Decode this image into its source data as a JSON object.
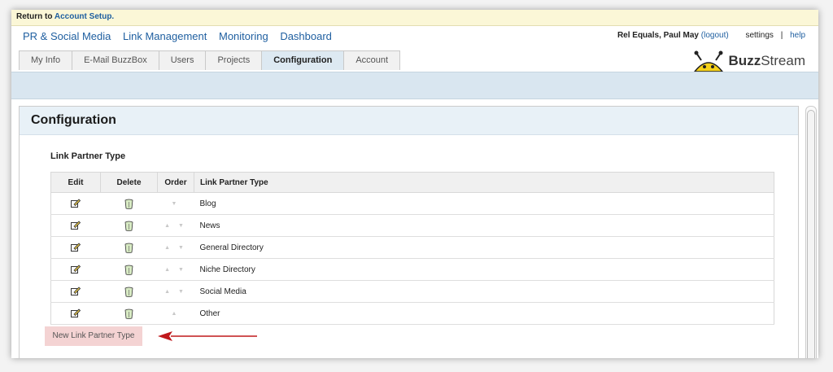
{
  "topbar": {
    "prefix": "Return to",
    "link": "Account Setup."
  },
  "mainnav": [
    "PR & Social Media",
    "Link Management",
    "Monitoring",
    "Dashboard"
  ],
  "user": {
    "name": "Rel Equals, Paul May",
    "logout": "(logout)",
    "settings": "settings",
    "separator": "|",
    "help": "help"
  },
  "brand": {
    "bold": "Buzz",
    "rest": "Stream"
  },
  "tabs": [
    "My Info",
    "E-Mail BuzzBox",
    "Users",
    "Projects",
    "Configuration",
    "Account"
  ],
  "active_tab": "Configuration",
  "page": {
    "title": "Configuration",
    "section": "Link Partner Type"
  },
  "table": {
    "headers": {
      "edit": "Edit",
      "delete": "Delete",
      "order": "Order",
      "type": "Link Partner Type"
    },
    "rows": [
      {
        "type": "Blog",
        "order": "▼"
      },
      {
        "type": "News",
        "order": "▲ ▼"
      },
      {
        "type": "General Directory",
        "order": "▲ ▼"
      },
      {
        "type": "Niche Directory",
        "order": "▲ ▼"
      },
      {
        "type": "Social Media",
        "order": "▲ ▼"
      },
      {
        "type": "Other",
        "order": "▲"
      }
    ]
  },
  "new_button": "New Link Partner Type",
  "colors": {
    "accent_blue": "#1f5fa0",
    "arrow_red": "#c0181c",
    "button_pink": "#f4d3d3"
  }
}
